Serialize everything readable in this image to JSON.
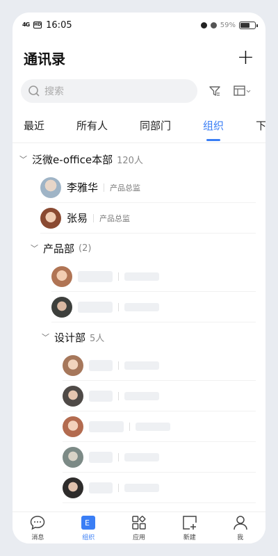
{
  "status": {
    "signal": "4G",
    "hd": "HD",
    "time": "16:05",
    "battery": "59%"
  },
  "header": {
    "title": "通讯录",
    "add_label": "+"
  },
  "search": {
    "placeholder": "搜索"
  },
  "tabs": [
    {
      "label": "最近",
      "active": false
    },
    {
      "label": "所有人",
      "active": false
    },
    {
      "label": "同部门",
      "active": false
    },
    {
      "label": "组织",
      "active": true
    },
    {
      "label": "下",
      "active": false
    }
  ],
  "tree": {
    "root": {
      "name": "泛微e-office本部",
      "count": "120人"
    },
    "members": [
      {
        "name": "李雅华",
        "role": "产品总监",
        "avatar": "#9fb4c6"
      },
      {
        "name": "张易",
        "role": "产品总监",
        "avatar": "#8a4a32"
      }
    ],
    "product": {
      "name": "产品部",
      "count": "(2)",
      "avatars": [
        "#b07454",
        "#3d3f3c"
      ]
    },
    "design": {
      "name": "设计部",
      "count": "5人",
      "avatars": [
        "#a6775b",
        "#4f4a47",
        "#b36b4f",
        "#7c8a86",
        "#2e2c2b"
      ]
    }
  },
  "nav": [
    {
      "label": "消息",
      "icon": "chat-icon",
      "active": false
    },
    {
      "label": "组织",
      "icon": "org-icon",
      "active": true
    },
    {
      "label": "应用",
      "icon": "apps-icon",
      "active": false
    },
    {
      "label": "新建",
      "icon": "new-icon",
      "active": false
    },
    {
      "label": "我",
      "icon": "person-icon",
      "active": false
    }
  ],
  "colors": {
    "accent": "#3a7ef5"
  }
}
